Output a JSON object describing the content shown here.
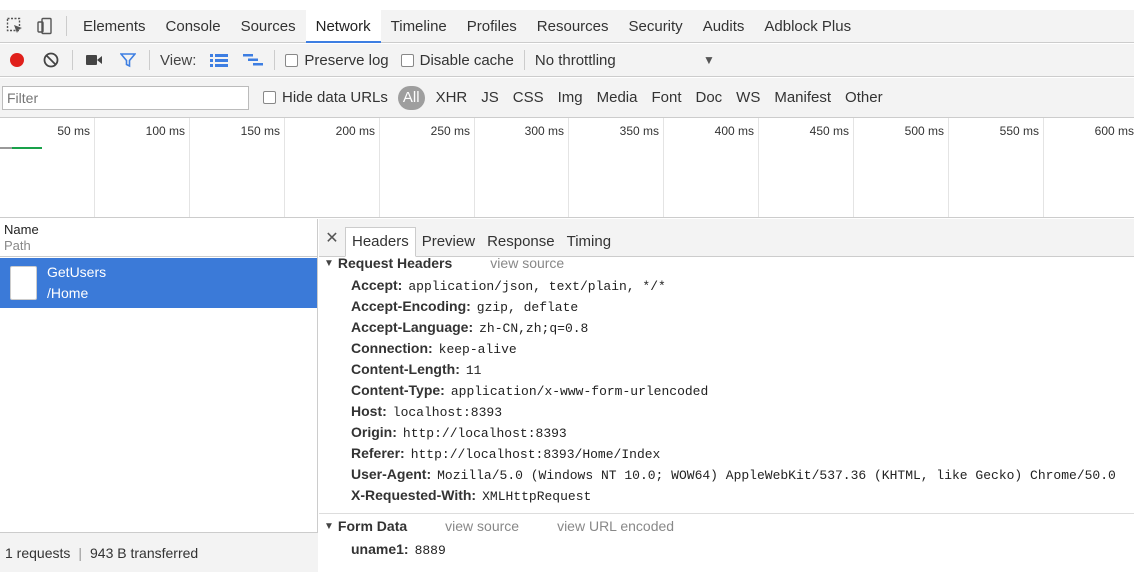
{
  "main_tabs": [
    "Elements",
    "Console",
    "Sources",
    "Network",
    "Timeline",
    "Profiles",
    "Resources",
    "Security",
    "Audits",
    "Adblock Plus"
  ],
  "active_tab": "Network",
  "toolbar": {
    "view_label": "View:",
    "preserve_log": "Preserve log",
    "disable_cache": "Disable cache",
    "throttling": "No throttling",
    "record_color": "#e0201b",
    "filter_icon_color": "#3d7ee2"
  },
  "filterbar": {
    "filter_placeholder": "Filter",
    "hide_data_urls": "Hide data URLs",
    "types": [
      "All",
      "XHR",
      "JS",
      "CSS",
      "Img",
      "Media",
      "Font",
      "Doc",
      "WS",
      "Manifest",
      "Other"
    ]
  },
  "overview": {
    "ticks": [
      "50 ms",
      "100 ms",
      "150 ms",
      "200 ms",
      "250 ms",
      "300 ms",
      "350 ms",
      "400 ms",
      "450 ms",
      "500 ms",
      "550 ms",
      "600 ms"
    ]
  },
  "list": {
    "name_header": "Name",
    "path_header": "Path",
    "request": {
      "name": "GetUsers",
      "path": "/Home"
    },
    "status": {
      "requests": "1 requests",
      "transferred": "943 B transferred"
    }
  },
  "details": {
    "tabs": [
      "Headers",
      "Preview",
      "Response",
      "Timing"
    ],
    "request_headers_title": "Request Headers",
    "view_source": "view source",
    "view_url_encoded": "view URL encoded",
    "request_headers": [
      {
        "key": "Accept:",
        "value": "application/json, text/plain, */*"
      },
      {
        "key": "Accept-Encoding:",
        "value": "gzip, deflate"
      },
      {
        "key": "Accept-Language:",
        "value": "zh-CN,zh;q=0.8"
      },
      {
        "key": "Connection:",
        "value": "keep-alive"
      },
      {
        "key": "Content-Length:",
        "value": "11"
      },
      {
        "key": "Content-Type:",
        "value": "application/x-www-form-urlencoded"
      },
      {
        "key": "Host:",
        "value": "localhost:8393"
      },
      {
        "key": "Origin:",
        "value": "http://localhost:8393"
      },
      {
        "key": "Referer:",
        "value": "http://localhost:8393/Home/Index"
      },
      {
        "key": "User-Agent:",
        "value": "Mozilla/5.0 (Windows NT 10.0; WOW64) AppleWebKit/537.36 (KHTML, like Gecko) Chrome/50.0"
      },
      {
        "key": "X-Requested-With:",
        "value": "XMLHttpRequest"
      }
    ],
    "form_data_title": "Form Data",
    "form_data": [
      {
        "key": "uname1:",
        "value": "8889"
      }
    ]
  }
}
